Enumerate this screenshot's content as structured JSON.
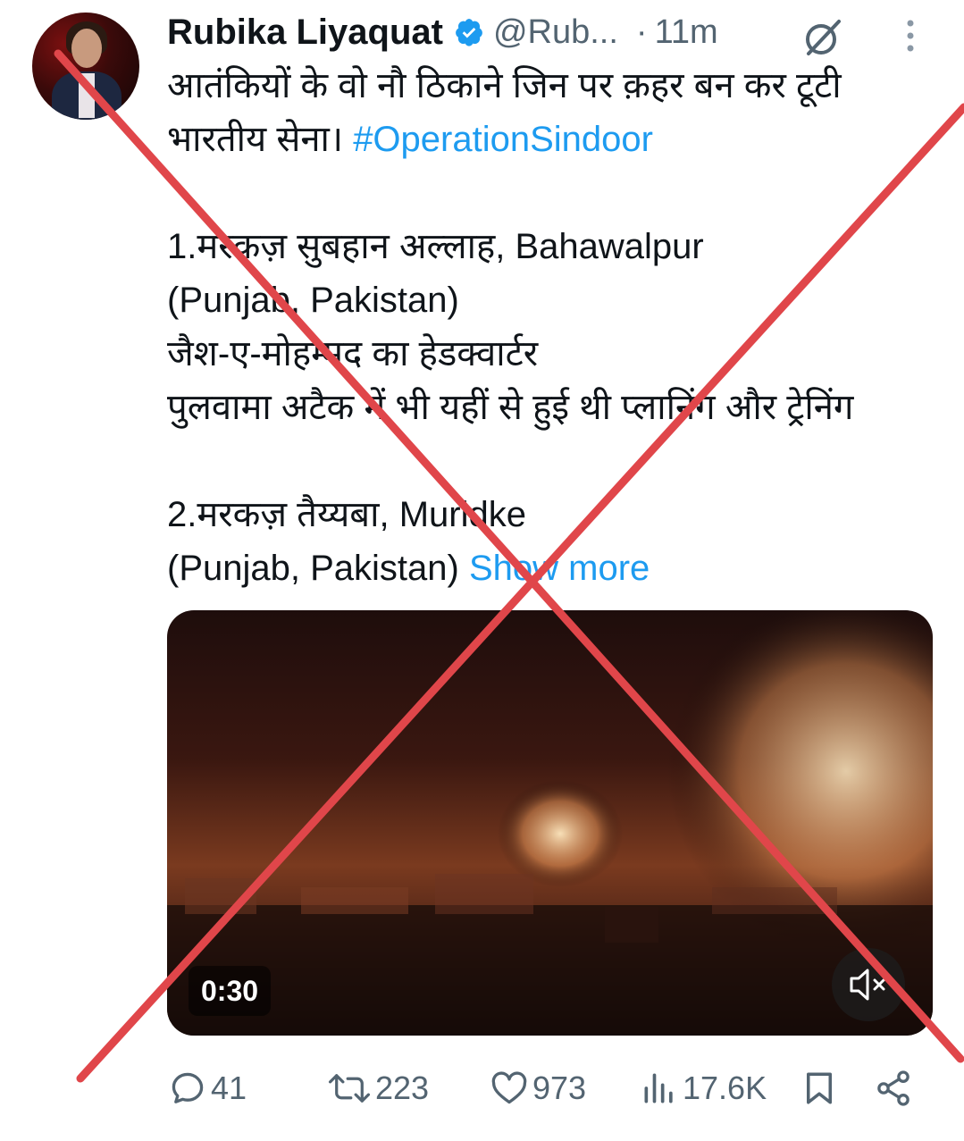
{
  "author": {
    "name": "Rubika Liyaquat",
    "handle": "@Rub...",
    "separator": "·",
    "time": "11m"
  },
  "post": {
    "line1": "आतंकियों के वो नौ ठिकाने जिन पर क़हर बन कर टूटी",
    "line2_text": "भारतीय सेना। ",
    "hashtag": "#OperationSindoor",
    "item1_title": "1.मरकज़ सुबहान अल्लाह, Bahawalpur",
    "item1_location": "(Punjab, Pakistan)",
    "item1_detail1": "जैश-ए-मोहम्मद का हेडक्वार्टर",
    "item1_detail2": "पुलवामा अटैक में भी  यहीं से हुई थी प्लानिंग और ट्रेनिंग",
    "item2_title": "2.मरकज़ तैय्यबा, Muridke",
    "item2_location": "(Punjab, Pakistan) ",
    "show_more": "Show more"
  },
  "media": {
    "duration": "0:30",
    "mute_icon": "speaker-muted-icon"
  },
  "actions": {
    "replies": "41",
    "reposts": "223",
    "likes": "973",
    "views": "17.6K"
  },
  "colors": {
    "accent": "#1d9bf0",
    "muted_text": "#536471",
    "overlay_cross": "#e0464a"
  }
}
